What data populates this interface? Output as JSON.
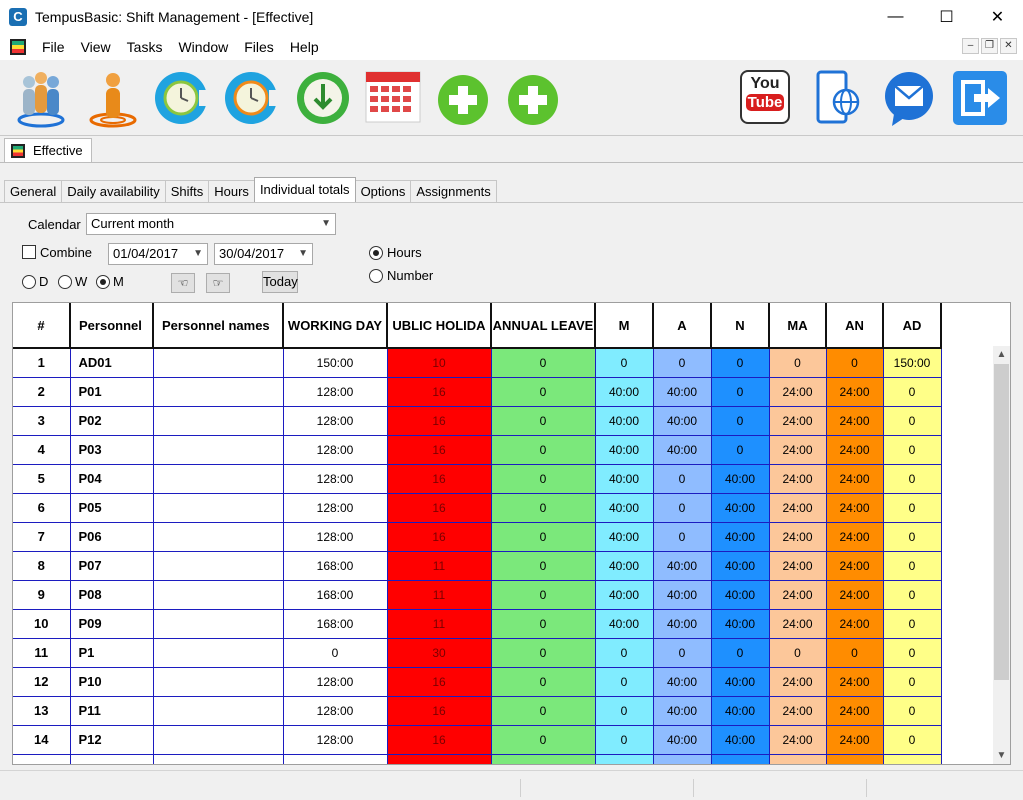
{
  "window": {
    "title": "TempusBasic: Shift Management - [Effective]"
  },
  "menu": [
    "File",
    "View",
    "Tasks",
    "Window",
    "Files",
    "Help"
  ],
  "toolbar": {
    "icons": [
      "personnel-group-icon",
      "person-target-icon",
      "clock-refresh-icon",
      "clock-progress-icon",
      "clock-download-icon",
      "calendar-icon",
      "add-icon",
      "add-icon",
      "youtube-icon",
      "web-help-icon",
      "email-icon",
      "exit-icon"
    ],
    "youtube_top": "You",
    "youtube_bottom": "Tube"
  },
  "doc_tab": {
    "label": "Effective"
  },
  "tabs": [
    "General",
    "Daily availability",
    "Shifts",
    "Hours",
    "Individual totals",
    "Options",
    "Assignments"
  ],
  "active_tab": "Individual totals",
  "form": {
    "calendar_label": "Calendar",
    "calendar_value": "Current month",
    "combine_label": "Combine",
    "date_from": "01/04/2017",
    "date_to": "30/04/2017",
    "radio_d": "D",
    "radio_w": "W",
    "radio_m": "M",
    "hours_label": "Hours",
    "number_label": "Number",
    "today_label": "Today"
  },
  "grid": {
    "headers": [
      "#",
      "Personnel",
      "Personnel names",
      "WORKING DAY",
      "UBLIC HOLIDA",
      "ANNUAL LEAVE",
      "M",
      "A",
      "N",
      "MA",
      "AN",
      "AD"
    ],
    "rows": [
      [
        "1",
        "AD01",
        "",
        "150:00",
        "10",
        "0",
        "0",
        "0",
        "0",
        "0",
        "0",
        "150:00"
      ],
      [
        "2",
        "P01",
        "",
        "128:00",
        "16",
        "0",
        "40:00",
        "40:00",
        "0",
        "24:00",
        "24:00",
        "0"
      ],
      [
        "3",
        "P02",
        "",
        "128:00",
        "16",
        "0",
        "40:00",
        "40:00",
        "0",
        "24:00",
        "24:00",
        "0"
      ],
      [
        "4",
        "P03",
        "",
        "128:00",
        "16",
        "0",
        "40:00",
        "40:00",
        "0",
        "24:00",
        "24:00",
        "0"
      ],
      [
        "5",
        "P04",
        "",
        "128:00",
        "16",
        "0",
        "40:00",
        "0",
        "40:00",
        "24:00",
        "24:00",
        "0"
      ],
      [
        "6",
        "P05",
        "",
        "128:00",
        "16",
        "0",
        "40:00",
        "0",
        "40:00",
        "24:00",
        "24:00",
        "0"
      ],
      [
        "7",
        "P06",
        "",
        "128:00",
        "16",
        "0",
        "40:00",
        "0",
        "40:00",
        "24:00",
        "24:00",
        "0"
      ],
      [
        "8",
        "P07",
        "",
        "168:00",
        "11",
        "0",
        "40:00",
        "40:00",
        "40:00",
        "24:00",
        "24:00",
        "0"
      ],
      [
        "9",
        "P08",
        "",
        "168:00",
        "11",
        "0",
        "40:00",
        "40:00",
        "40:00",
        "24:00",
        "24:00",
        "0"
      ],
      [
        "10",
        "P09",
        "",
        "168:00",
        "11",
        "0",
        "40:00",
        "40:00",
        "40:00",
        "24:00",
        "24:00",
        "0"
      ],
      [
        "11",
        "P1",
        "",
        "0",
        "30",
        "0",
        "0",
        "0",
        "0",
        "0",
        "0",
        "0"
      ],
      [
        "12",
        "P10",
        "",
        "128:00",
        "16",
        "0",
        "0",
        "40:00",
        "40:00",
        "24:00",
        "24:00",
        "0"
      ],
      [
        "13",
        "P11",
        "",
        "128:00",
        "16",
        "0",
        "0",
        "40:00",
        "40:00",
        "24:00",
        "24:00",
        "0"
      ],
      [
        "14",
        "P12",
        "",
        "128:00",
        "16",
        "0",
        "0",
        "40:00",
        "40:00",
        "24:00",
        "24:00",
        "0"
      ],
      [
        "",
        "",
        "",
        "",
        "",
        "",
        "",
        "",
        "",
        "",
        "",
        ""
      ]
    ],
    "column_colors": [
      "#ffffff",
      "#ffffff",
      "#ffffff",
      "#ffffff",
      "#ff0000",
      "#7be87b",
      "#80ecff",
      "#8fbcff",
      "#1e90ff",
      "#fcc79a",
      "#ff8c00",
      "#ffff88"
    ]
  }
}
